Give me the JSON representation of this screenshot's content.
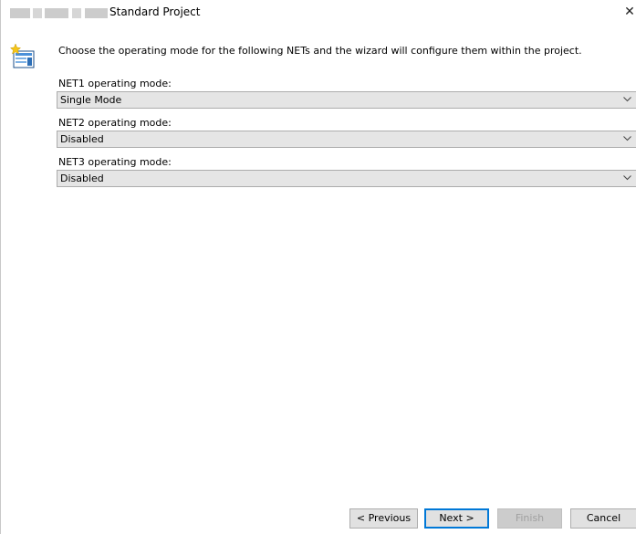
{
  "window": {
    "title": "Standard Project",
    "close_glyph": "✕"
  },
  "page": {
    "icon": "wizard-icon",
    "intro": "Choose the operating mode for the following NETs and the wizard will configure them within the project."
  },
  "fields": [
    {
      "label": "NET1 operating mode:",
      "value": "Single Mode"
    },
    {
      "label": "NET2 operating mode:",
      "value": "Disabled"
    },
    {
      "label": "NET3 operating mode:",
      "value": "Disabled"
    }
  ],
  "buttons": {
    "previous": "< Previous",
    "next": "Next >",
    "finish": "Finish",
    "cancel": "Cancel"
  },
  "colors": {
    "accent": "#0078d7",
    "combo_bg": "#e5e5e5"
  }
}
